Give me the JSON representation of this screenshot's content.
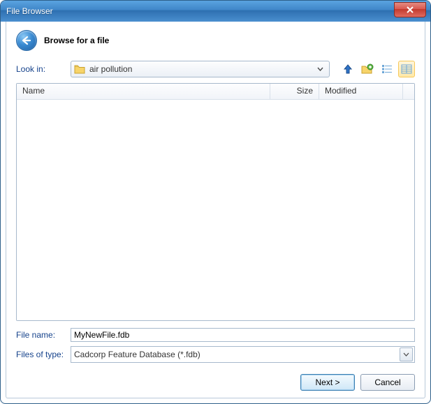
{
  "window": {
    "title": "File Browser"
  },
  "header": {
    "subtitle": "Browse for a file"
  },
  "lookin": {
    "label": "Look in:",
    "folder_icon": "folder-icon",
    "value": "air pollution"
  },
  "toolbar_icons": {
    "up": "up-arrow-icon",
    "new_folder": "new-folder-icon",
    "details_view": "details-view-icon",
    "list_view": "list-view-icon"
  },
  "columns": {
    "name": "Name",
    "size": "Size",
    "modified": "Modified"
  },
  "filename": {
    "label": "File name:",
    "value": "MyNewFile.fdb"
  },
  "filetype": {
    "label": "Files of type:",
    "value": "Cadcorp Feature Database (*.fdb)"
  },
  "buttons": {
    "next": "Next >",
    "cancel": "Cancel"
  }
}
